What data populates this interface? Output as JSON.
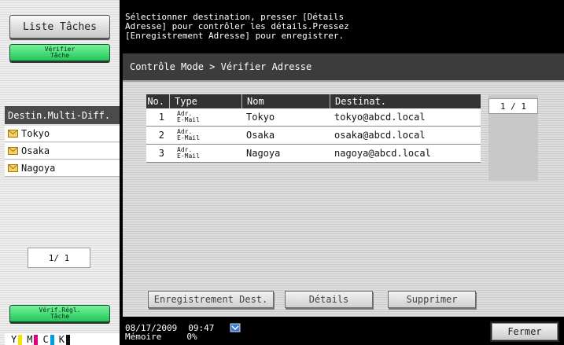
{
  "left_panel": {
    "job_list_button": "Liste Tâches",
    "verify_job_button": [
      "Vérifier",
      "Tâche"
    ],
    "multi_dest_header": "Destin.Multi-Diff.",
    "destinations": [
      "Tokyo",
      "Osaka",
      "Nagoya"
    ],
    "page_indicator": "1/  1",
    "verify_settings_button": [
      "Vérif.Régl.",
      "Tâche"
    ],
    "toner": [
      "Y",
      "M",
      "C",
      "K"
    ]
  },
  "message": "Sélectionner destination, presser [Détails\nAdresse] pour contrôler les détails.Pressez\n[Enregistrement Adresse] pour enregistrer.",
  "breadcrumb": "Contrôle Mode > Vérifier Adresse",
  "table": {
    "headers": [
      "No.",
      "Type",
      "Nom",
      "Destinat."
    ],
    "rows": [
      {
        "no": "1",
        "type": [
          "Adr.",
          "E-Mail"
        ],
        "nom": "Tokyo",
        "dest": "tokyo@abcd.local"
      },
      {
        "no": "2",
        "type": [
          "Adr.",
          "E-Mail"
        ],
        "nom": "Osaka",
        "dest": "osaka@abcd.local"
      },
      {
        "no": "3",
        "type": [
          "Adr.",
          "E-Mail"
        ],
        "nom": "Nagoya",
        "dest": "nagoya@abcd.local"
      }
    ]
  },
  "page_indicator": "1 / 1",
  "actions": {
    "register": "Enregistrement Dest.",
    "details": "Détails",
    "delete": "Supprimer"
  },
  "status": {
    "date": "08/17/2009",
    "time": "09:47",
    "memory_label": "Mémoire",
    "memory_value": "0%"
  },
  "close_button": "Fermer",
  "colors": {
    "green_button": "#2ecc65",
    "toner_y": "#f2e600",
    "toner_m": "#e0007a",
    "toner_c": "#00a0e0",
    "toner_k": "#111111",
    "envelope": "#f0c030"
  }
}
